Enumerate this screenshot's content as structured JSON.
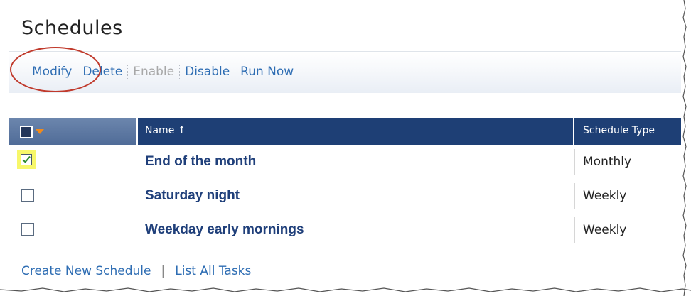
{
  "page": {
    "title": "Schedules"
  },
  "toolbar": {
    "modify": "Modify",
    "delete": "Delete",
    "enable": "Enable",
    "disable": "Disable",
    "run_now": "Run Now"
  },
  "table": {
    "columns": {
      "name": "Name",
      "sort_icon": "↑",
      "schedule_type": "Schedule Type"
    },
    "rows": [
      {
        "name": "End of the month",
        "type": "Monthly",
        "checked": true
      },
      {
        "name": "Saturday night",
        "type": "Weekly",
        "checked": false
      },
      {
        "name": "Weekday early mornings",
        "type": "Weekly",
        "checked": false
      }
    ]
  },
  "footer": {
    "create": "Create New Schedule",
    "separator": "|",
    "list_tasks": "List All Tasks"
  },
  "colors": {
    "link": "#2e6db3",
    "header_dark": "#1e3f75",
    "header_light": "#6c86ad",
    "annotation": "#c0392b",
    "highlight": "#f7f76a"
  }
}
